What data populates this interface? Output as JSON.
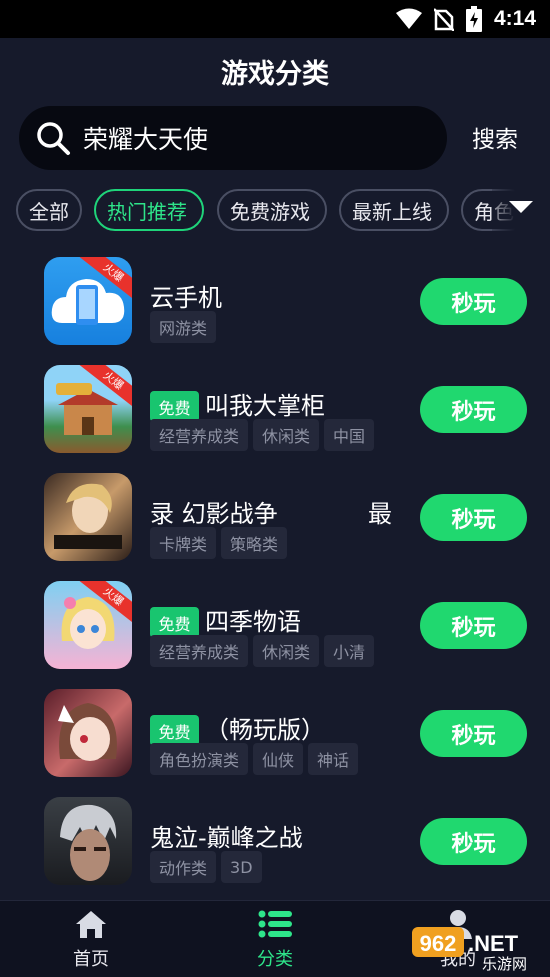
{
  "status_bar": {
    "time": "4:14",
    "icons": [
      "wifi-icon",
      "no-sim-icon",
      "battery-charging-icon"
    ]
  },
  "header": {
    "title": "游戏分类"
  },
  "search": {
    "value": "荣耀大天使",
    "button_label": "搜索",
    "icon": "search-icon"
  },
  "tabs": [
    {
      "label": "全部",
      "active": false
    },
    {
      "label": "热门推荐",
      "active": true
    },
    {
      "label": "免费游戏",
      "active": false
    },
    {
      "label": "最新上线",
      "active": false
    },
    {
      "label": "角色",
      "active": false
    }
  ],
  "games": [
    {
      "name": "云手机",
      "free": false,
      "hot": true,
      "tags": [
        "网游类"
      ],
      "button": "秒玩"
    },
    {
      "name": "叫我大掌柜",
      "free": true,
      "free_label": "免费",
      "hot": true,
      "tags": [
        "经营养成类",
        "休闲类",
        "中国"
      ],
      "button": "秒玩"
    },
    {
      "name": "录 幻影战争",
      "name_trail": "最",
      "free": false,
      "hot": false,
      "tags": [
        "卡牌类",
        "策略类"
      ],
      "button": "秒玩"
    },
    {
      "name": "四季物语",
      "free": true,
      "free_label": "免费",
      "hot": true,
      "tags": [
        "经营养成类",
        "休闲类",
        "小清"
      ],
      "button": "秒玩"
    },
    {
      "name": "（畅玩版）",
      "free": true,
      "free_label": "免费",
      "hot": false,
      "tags": [
        "角色扮演类",
        "仙侠",
        "神话"
      ],
      "button": "秒玩"
    },
    {
      "name": "鬼泣-巅峰之战",
      "free": false,
      "hot": false,
      "tags": [
        "动作类",
        "3D"
      ],
      "button": "秒玩"
    }
  ],
  "hot_label": "火爆",
  "bottom_nav": [
    {
      "label": "首页",
      "icon": "home-icon",
      "active": false
    },
    {
      "label": "分类",
      "icon": "list-icon",
      "active": true
    },
    {
      "label": "我的",
      "icon": "user-icon",
      "active": false
    }
  ],
  "watermark": {
    "number": "962",
    "suffix": ".NET",
    "text": "乐游网"
  },
  "colors": {
    "background": "#161a2b",
    "accent": "#20d86f",
    "hot": "#e8322c",
    "tag_bg": "#24283a",
    "tag_text": "#8e92a3"
  }
}
